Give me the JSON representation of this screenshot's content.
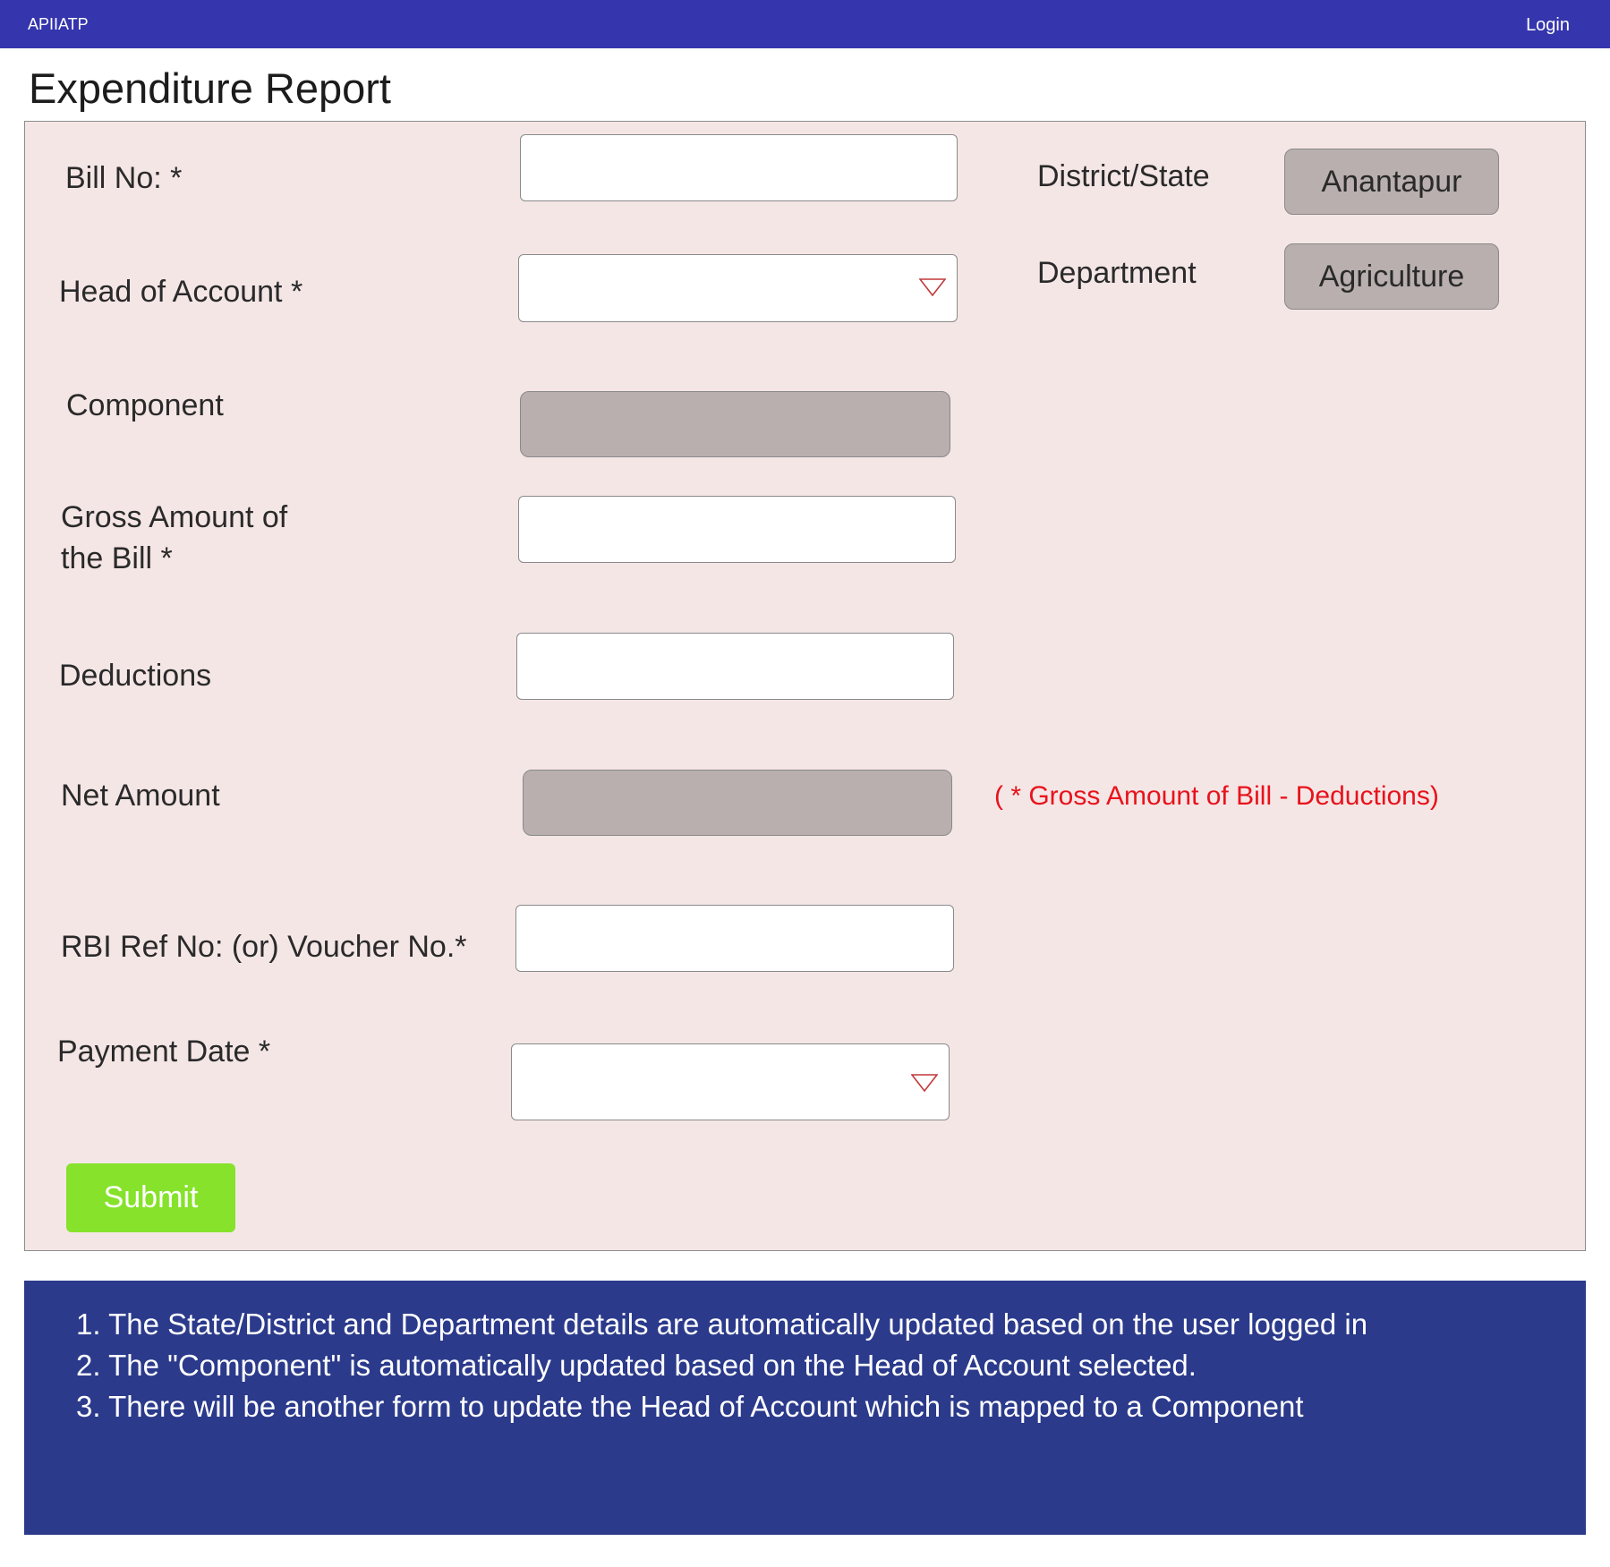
{
  "header": {
    "brand": "APIIATP",
    "login_label": "Login"
  },
  "page": {
    "title": "Expenditure Report"
  },
  "form": {
    "bill_no": {
      "label": "Bill No: *",
      "value": ""
    },
    "head_of_account": {
      "label": "Head of Account *",
      "value": ""
    },
    "component": {
      "label": "Component",
      "value": ""
    },
    "gross_amount": {
      "label_line1": "Gross Amount of",
      "label_line2": "the Bill *",
      "value": ""
    },
    "deductions": {
      "label": "Deductions",
      "value": ""
    },
    "net_amount": {
      "label": "Net Amount",
      "value": "",
      "note": "( * Gross Amount of Bill - Deductions)"
    },
    "rbi_ref": {
      "label": "RBI Ref No: (or) Voucher No.*",
      "value": ""
    },
    "payment_date": {
      "label": "Payment Date *",
      "value": ""
    },
    "district_state": {
      "label": "District/State",
      "value": "Anantapur"
    },
    "department": {
      "label": "Department",
      "value": "Agriculture"
    },
    "submit_label": "Submit"
  },
  "notes": {
    "items": [
      "1. The State/District and Department details are automatically updated based on the user logged in",
      "2. The \"Component\" is automatically updated based on the Head of Account selected.",
      "3. There will be another form to update the Head of Account which is mapped to a Component"
    ]
  },
  "colors": {
    "header_bg": "#3535ad",
    "panel_bg": "#f5e6e6",
    "readonly_bg": "#b8afae",
    "submit_bg": "#86e22a",
    "note_red": "#e8121b",
    "info_bg": "#2b3a8b"
  },
  "icons": {
    "dropdown": "chevron-down-icon"
  }
}
